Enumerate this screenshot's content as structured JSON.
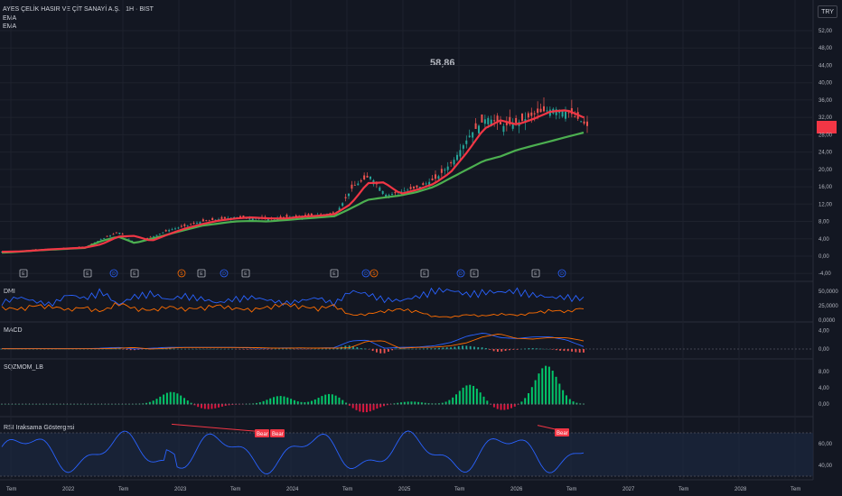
{
  "header": {
    "symbol_title": "AYES ÇELİK HASIR VE ÇİT SANAYİ A.Ş. · 1H · BIST",
    "ind1": "EMA",
    "ind2": "EMA"
  },
  "currency": "TRY",
  "big_value": "58,86",
  "colors": {
    "background": "#131722",
    "ema_fast": "#f23645",
    "ema_slow": "#4caf50",
    "candle_up": "#26a69a",
    "candle_down": "#ef5350",
    "dmi_plus": "#2962ff",
    "dmi_minus": "#ff6d00",
    "rsi": "#2962ff",
    "divergence": "#f23645",
    "earnings_marker": "#b2b5be",
    "dividend_marker": "#2962ff",
    "split_marker": "#ff6d00"
  },
  "chart_data": [
    {
      "type": "line",
      "x": [
        "2021-06",
        "2021-09",
        "2022",
        "2022-04",
        "2022-07",
        "2022-10",
        "2023",
        "2023-02",
        "2023-04",
        "2023-07",
        "2023-09",
        "2023-11",
        "2024",
        "2024-03",
        "2024-05",
        "2024-07",
        "2024-09",
        "2024-11",
        "2025",
        "2025-03",
        "2025-05",
        "2025-06",
        "2025-07",
        "2025-08",
        "2025-10",
        "2025-12",
        "2026",
        "2026-02",
        "2026-03",
        "2026-04",
        "2026-05",
        "2026-06",
        "2026-07",
        "2026-08",
        "2026-09",
        "2026-10"
      ],
      "series": [
        {
          "values": [
            1.0,
            1.2,
            1.5,
            1.7,
            1.9,
            2.1,
            4.0,
            5.5,
            3.0,
            4.5,
            6.0,
            7.0,
            8.0,
            8.5,
            9.0,
            8.8,
            8.5,
            9.0,
            9.2,
            9.5,
            10.0,
            16.0,
            18.5,
            14.0,
            15.0,
            16.0,
            18.0,
            22.0,
            28.0,
            32.0,
            30.0,
            31.0,
            33.0,
            34.0,
            33.0,
            30.0
          ]
        },
        {
          "values": [
            0.8,
            1.0,
            1.3,
            1.5,
            1.7,
            1.9,
            3.5,
            4.5,
            3.0,
            4.0,
            5.0,
            6.0,
            7.0,
            7.5,
            8.0,
            8.1,
            8.0,
            8.3,
            8.6,
            8.9,
            9.2,
            11.0,
            13.0,
            13.5,
            14.0,
            14.8,
            16.0,
            18.0,
            20.0,
            22.0,
            23.0,
            24.5,
            25.5,
            26.5,
            27.5,
            28.5
          ]
        }
      ],
      "ylim": [
        -4,
        52
      ],
      "y_ticks": [
        "52,00",
        "48,00",
        "44,00",
        "40,00",
        "36,00",
        "32,00",
        "28,00",
        "24,00",
        "20,00",
        "16,00",
        "12,00",
        "8,00",
        "4,00",
        "0,00",
        "-4,00"
      ]
    },
    {
      "type": "line",
      "title": "DMI",
      "series": [
        {
          "values": [
            30000,
            38000,
            31000,
            27000,
            42000,
            36000,
            49000,
            25000,
            40000,
            45000,
            33000,
            41000,
            36000,
            28000,
            36000,
            38000,
            33000,
            29000,
            32000,
            37000,
            28000,
            48000,
            43000,
            35000,
            32000,
            39000,
            50000,
            49000,
            43000,
            47000,
            46000,
            49000,
            42000,
            37000,
            39000,
            36000
          ]
        },
        {
          "values": [
            20000,
            18000,
            24000,
            22000,
            17000,
            21000,
            14000,
            28000,
            19000,
            16000,
            22000,
            18000,
            20000,
            24000,
            19000,
            17000,
            21000,
            26000,
            22000,
            19000,
            24000,
            8000,
            10000,
            15000,
            18000,
            14000,
            6000,
            5000,
            9000,
            7000,
            10000,
            8000,
            12000,
            16000,
            14000,
            20000
          ]
        }
      ],
      "y_ticks": [
        "50,0000",
        "25,0000",
        "0,0000"
      ]
    },
    {
      "type": "bar",
      "title": "MACD",
      "y_ticks": [
        "4,00",
        "0,00"
      ]
    },
    {
      "type": "bar",
      "title": "SQZMOM_LB",
      "y_ticks": [
        "8,00",
        "4,00",
        "0,00"
      ]
    },
    {
      "type": "line",
      "title": "RSI Iraksama Göstergesi",
      "y_ticks": [
        "60,00",
        "40,00"
      ],
      "divergence_labels": [
        "Bear",
        "Bear",
        "Bear"
      ]
    }
  ],
  "x_axis": [
    "Tem",
    "2022",
    "Tem",
    "2023",
    "Tem",
    "2024",
    "Tem",
    "2025",
    "Tem",
    "2026",
    "Tem",
    "2027",
    "Tem",
    "2028",
    "Tem"
  ],
  "event_markers": [
    "E",
    "E",
    "D",
    "E",
    "S",
    "E",
    "D",
    "E",
    "E",
    "D",
    "S",
    "E",
    "D",
    "E",
    "E",
    "D"
  ]
}
